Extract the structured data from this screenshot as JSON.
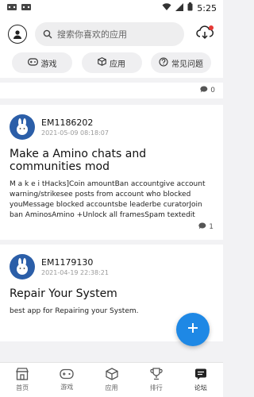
{
  "status_bar": {
    "time": "5:25"
  },
  "header": {
    "search_placeholder": "搜索你喜欢的应用",
    "icons": {
      "avatar": "user-icon",
      "search": "search-icon",
      "download": "cloud-download-icon"
    }
  },
  "tabs": [
    {
      "label": "游戏",
      "icon": "gamepad-icon"
    },
    {
      "label": "应用",
      "icon": "cube-icon"
    },
    {
      "label": "常见问题",
      "icon": "question-icon"
    }
  ],
  "pinned": {
    "comment_count": "0"
  },
  "posts": [
    {
      "user": "EM1186202",
      "date": "2021-05-09 08:18:07",
      "title": "Make a Amino chats and communities mod",
      "body": "M a k e i tHacks]Coin amountBan accountgive account warning/strikesee posts from account who blocked youMessage blocked accountsbe leaderbe curatorJoin ban AminosAmino +Unlock all framesSpam textedit",
      "comment_count": "1"
    },
    {
      "user": "EM1179130",
      "date": "2021-04-19 22:38:21",
      "title": "Repair Your System",
      "body": "best app for Repairing your System."
    }
  ],
  "bottom_nav": [
    {
      "label": "首页",
      "icon": "store-icon"
    },
    {
      "label": "游戏",
      "icon": "gamepad-icon"
    },
    {
      "label": "应用",
      "icon": "cube-icon"
    },
    {
      "label": "排行",
      "icon": "trophy-icon"
    },
    {
      "label": "论坛",
      "icon": "chat-icon"
    }
  ],
  "colors": {
    "accent": "#1e88e5",
    "notification": "#e53935",
    "avatar_bg": "#2b5ea8"
  }
}
